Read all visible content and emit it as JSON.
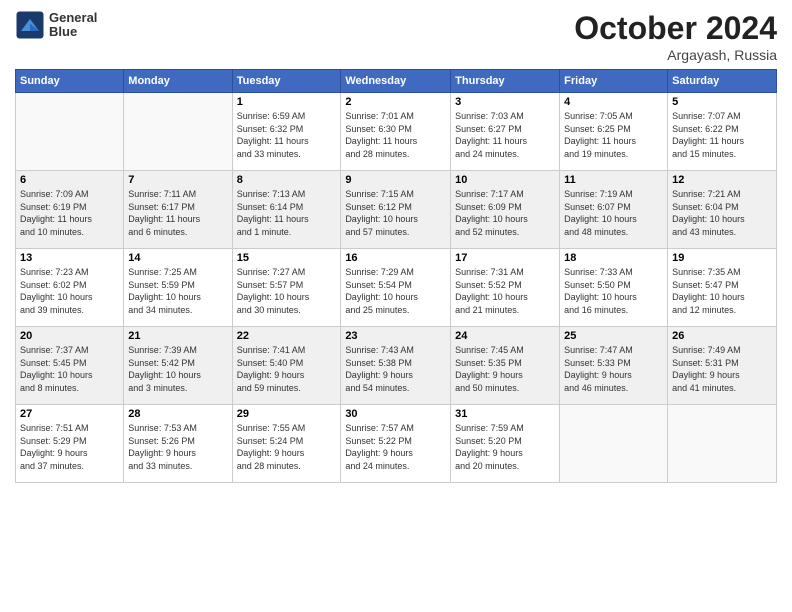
{
  "header": {
    "logo_line1": "General",
    "logo_line2": "Blue",
    "month": "October 2024",
    "location": "Argayash, Russia"
  },
  "days_of_week": [
    "Sunday",
    "Monday",
    "Tuesday",
    "Wednesday",
    "Thursday",
    "Friday",
    "Saturday"
  ],
  "weeks": [
    [
      {
        "day": "",
        "info": ""
      },
      {
        "day": "",
        "info": ""
      },
      {
        "day": "1",
        "info": "Sunrise: 6:59 AM\nSunset: 6:32 PM\nDaylight: 11 hours\nand 33 minutes."
      },
      {
        "day": "2",
        "info": "Sunrise: 7:01 AM\nSunset: 6:30 PM\nDaylight: 11 hours\nand 28 minutes."
      },
      {
        "day": "3",
        "info": "Sunrise: 7:03 AM\nSunset: 6:27 PM\nDaylight: 11 hours\nand 24 minutes."
      },
      {
        "day": "4",
        "info": "Sunrise: 7:05 AM\nSunset: 6:25 PM\nDaylight: 11 hours\nand 19 minutes."
      },
      {
        "day": "5",
        "info": "Sunrise: 7:07 AM\nSunset: 6:22 PM\nDaylight: 11 hours\nand 15 minutes."
      }
    ],
    [
      {
        "day": "6",
        "info": "Sunrise: 7:09 AM\nSunset: 6:19 PM\nDaylight: 11 hours\nand 10 minutes."
      },
      {
        "day": "7",
        "info": "Sunrise: 7:11 AM\nSunset: 6:17 PM\nDaylight: 11 hours\nand 6 minutes."
      },
      {
        "day": "8",
        "info": "Sunrise: 7:13 AM\nSunset: 6:14 PM\nDaylight: 11 hours\nand 1 minute."
      },
      {
        "day": "9",
        "info": "Sunrise: 7:15 AM\nSunset: 6:12 PM\nDaylight: 10 hours\nand 57 minutes."
      },
      {
        "day": "10",
        "info": "Sunrise: 7:17 AM\nSunset: 6:09 PM\nDaylight: 10 hours\nand 52 minutes."
      },
      {
        "day": "11",
        "info": "Sunrise: 7:19 AM\nSunset: 6:07 PM\nDaylight: 10 hours\nand 48 minutes."
      },
      {
        "day": "12",
        "info": "Sunrise: 7:21 AM\nSunset: 6:04 PM\nDaylight: 10 hours\nand 43 minutes."
      }
    ],
    [
      {
        "day": "13",
        "info": "Sunrise: 7:23 AM\nSunset: 6:02 PM\nDaylight: 10 hours\nand 39 minutes."
      },
      {
        "day": "14",
        "info": "Sunrise: 7:25 AM\nSunset: 5:59 PM\nDaylight: 10 hours\nand 34 minutes."
      },
      {
        "day": "15",
        "info": "Sunrise: 7:27 AM\nSunset: 5:57 PM\nDaylight: 10 hours\nand 30 minutes."
      },
      {
        "day": "16",
        "info": "Sunrise: 7:29 AM\nSunset: 5:54 PM\nDaylight: 10 hours\nand 25 minutes."
      },
      {
        "day": "17",
        "info": "Sunrise: 7:31 AM\nSunset: 5:52 PM\nDaylight: 10 hours\nand 21 minutes."
      },
      {
        "day": "18",
        "info": "Sunrise: 7:33 AM\nSunset: 5:50 PM\nDaylight: 10 hours\nand 16 minutes."
      },
      {
        "day": "19",
        "info": "Sunrise: 7:35 AM\nSunset: 5:47 PM\nDaylight: 10 hours\nand 12 minutes."
      }
    ],
    [
      {
        "day": "20",
        "info": "Sunrise: 7:37 AM\nSunset: 5:45 PM\nDaylight: 10 hours\nand 8 minutes."
      },
      {
        "day": "21",
        "info": "Sunrise: 7:39 AM\nSunset: 5:42 PM\nDaylight: 10 hours\nand 3 minutes."
      },
      {
        "day": "22",
        "info": "Sunrise: 7:41 AM\nSunset: 5:40 PM\nDaylight: 9 hours\nand 59 minutes."
      },
      {
        "day": "23",
        "info": "Sunrise: 7:43 AM\nSunset: 5:38 PM\nDaylight: 9 hours\nand 54 minutes."
      },
      {
        "day": "24",
        "info": "Sunrise: 7:45 AM\nSunset: 5:35 PM\nDaylight: 9 hours\nand 50 minutes."
      },
      {
        "day": "25",
        "info": "Sunrise: 7:47 AM\nSunset: 5:33 PM\nDaylight: 9 hours\nand 46 minutes."
      },
      {
        "day": "26",
        "info": "Sunrise: 7:49 AM\nSunset: 5:31 PM\nDaylight: 9 hours\nand 41 minutes."
      }
    ],
    [
      {
        "day": "27",
        "info": "Sunrise: 7:51 AM\nSunset: 5:29 PM\nDaylight: 9 hours\nand 37 minutes."
      },
      {
        "day": "28",
        "info": "Sunrise: 7:53 AM\nSunset: 5:26 PM\nDaylight: 9 hours\nand 33 minutes."
      },
      {
        "day": "29",
        "info": "Sunrise: 7:55 AM\nSunset: 5:24 PM\nDaylight: 9 hours\nand 28 minutes."
      },
      {
        "day": "30",
        "info": "Sunrise: 7:57 AM\nSunset: 5:22 PM\nDaylight: 9 hours\nand 24 minutes."
      },
      {
        "day": "31",
        "info": "Sunrise: 7:59 AM\nSunset: 5:20 PM\nDaylight: 9 hours\nand 20 minutes."
      },
      {
        "day": "",
        "info": ""
      },
      {
        "day": "",
        "info": ""
      }
    ]
  ]
}
